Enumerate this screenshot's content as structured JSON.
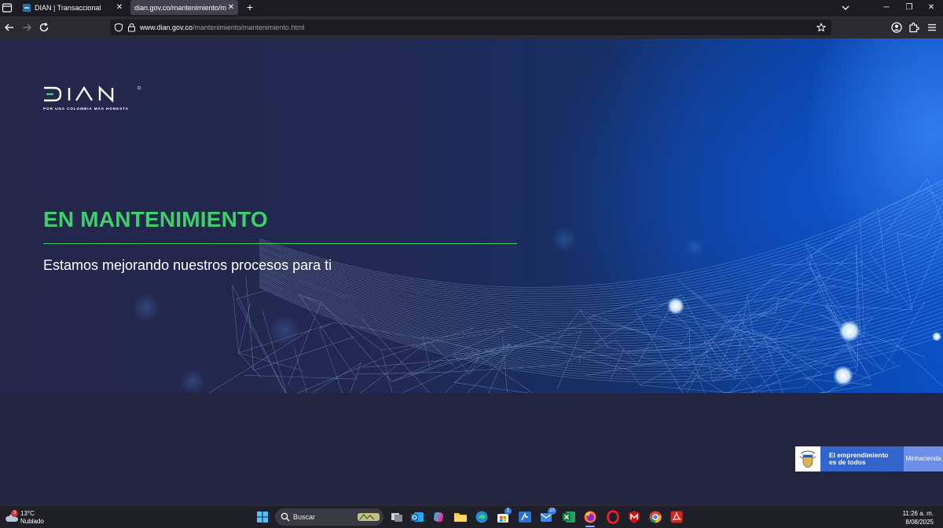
{
  "browser": {
    "tabs": [
      {
        "title": "DIAN | Transaccional",
        "active": false
      },
      {
        "title": "dian.gov.co/mantenimiento/mante",
        "active": true
      }
    ],
    "new_tab_icon": "plus-icon",
    "url_host": "www.dian.gov.co",
    "url_path": "/mantenimiento/mantenimiento.html"
  },
  "page": {
    "logo": {
      "wordmark": "DIAN",
      "tagline": "POR UNA COLOMBIA MÁS HONESTA"
    },
    "headline": "EN MANTENIMIENTO",
    "subline": "Estamos mejorando nuestros procesos para ti",
    "gov_badge": {
      "slogan_line1": "El emprendimiento",
      "slogan_line2": "es de todos",
      "ministry": "Minhacienda"
    },
    "colors": {
      "accent": "#3ecf6b",
      "background": "#222440",
      "hero_blue": "#0a50c6",
      "badge_blue": "#3366cc",
      "badge_light": "#6d8fe6"
    }
  },
  "taskbar": {
    "weather_temp": "13°C",
    "weather_desc": "Nublado",
    "weather_count": "3",
    "search_placeholder": "Buscar",
    "store_badge": "1",
    "mail_badge": "10",
    "time": "11:26 a. m.",
    "date": "8/08/2025"
  }
}
